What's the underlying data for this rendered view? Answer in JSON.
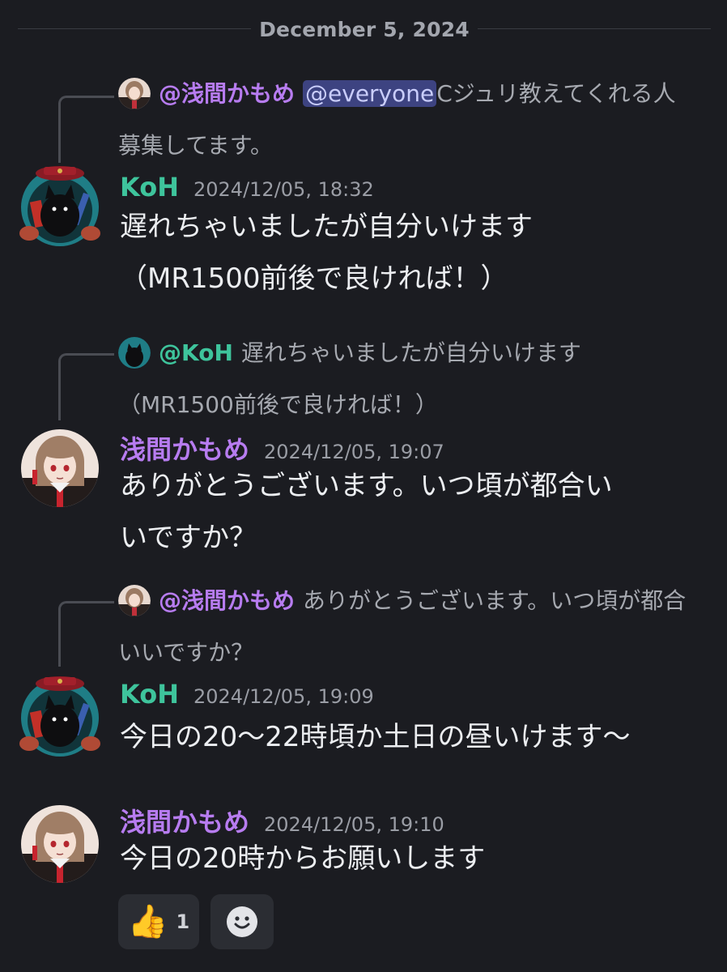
{
  "date_divider": "December 5, 2024",
  "colors": {
    "background": "#1b1c21",
    "koh_name": "#3ec49c",
    "asama_name": "#b77cf0",
    "mention_bg": "#3d4381"
  },
  "messages": [
    {
      "reply": {
        "author": "@浅間かもめ",
        "mention": "@everyone",
        "text": "Cジュリ教えてくれる人募集してます。"
      },
      "author": "KoH",
      "timestamp": "2024/12/05, 18:32",
      "lines": [
        "遅れちゃいましたが自分いけます",
        "（MR1500前後で良ければ！）"
      ],
      "avatar_icon": "black-cat-avatar"
    },
    {
      "reply": {
        "author": "@KoH",
        "text": "遅れちゃいましたが自分いけます（MR1500前後で良ければ！）"
      },
      "author": "浅間かもめ",
      "timestamp": "2024/12/05, 19:07",
      "lines": [
        "ありがとうございます。いつ頃が都合い",
        "いですか？"
      ],
      "avatar_icon": "anime-girl-avatar"
    },
    {
      "reply": {
        "author": "@浅間かもめ",
        "text": "ありがとうございます。いつ頃が都合いいですか？"
      },
      "author": "KoH",
      "timestamp": "2024/12/05, 19:09",
      "lines": [
        "今日の20〜22時頃か土日の昼いけます〜"
      ],
      "avatar_icon": "black-cat-avatar"
    },
    {
      "author": "浅間かもめ",
      "timestamp": "2024/12/05, 19:10",
      "lines": [
        "今日の20時からお願いします"
      ],
      "avatar_icon": "anime-girl-avatar",
      "reactions": [
        {
          "emoji": "👍",
          "count": "1",
          "icon": "thumbs-up-icon"
        },
        {
          "icon": "add-reaction-icon"
        }
      ]
    }
  ]
}
